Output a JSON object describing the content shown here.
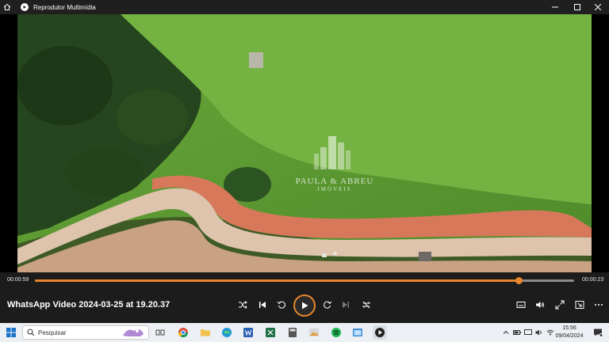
{
  "window": {
    "title": "Reprodutor Multimídia"
  },
  "video": {
    "watermark_name": "PAULA & ABREU",
    "watermark_sub": "IMÓVEIS"
  },
  "player": {
    "elapsed": "00:00:59",
    "remaining": "00:00:23",
    "progress_fraction": 0.897,
    "file_name": "WhatsApp Video 2024-03-25 at 19.20.37"
  },
  "taskbar": {
    "search_placeholder": "Pesquisar",
    "time": "15:56",
    "date": "09/04/2024"
  },
  "colors": {
    "accent": "#e8862d",
    "titlebar": "#1f1f1f",
    "controls_bg": "#1c1c1c",
    "taskbar_bg": "#eceff4"
  }
}
